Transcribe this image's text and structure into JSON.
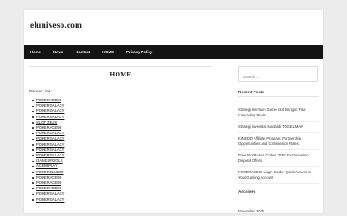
{
  "site": {
    "title": "eluniveso.com"
  },
  "nav": {
    "items": [
      {
        "label": "Home"
      },
      {
        "label": "News"
      },
      {
        "label": "Contact"
      },
      {
        "label": "HOME"
      },
      {
        "label": "Privacy Policy"
      }
    ]
  },
  "main": {
    "page_title": "HOME",
    "partner_label": "Partner Link:",
    "links": [
      "POKERACE99",
      "POKERGALAXY",
      "POKERGALAXY",
      "POKERGALAXY",
      "SLOT ZEUS",
      "POKERACE99",
      "POKERGALAXY",
      "POKERGALAXY",
      "POKERGALAXY",
      "POKERGALAXY",
      "POKERGALAXY",
      "GAMESPOOLS",
      "ACE99PLAY",
      "POKERCLUB88",
      "POKERACE99",
      "POKERACE99",
      "POKERACE99",
      "POKERGALAXY",
      "POKERGALAXY"
    ]
  },
  "sidebar": {
    "search": {
      "placeholder": "Search …"
    },
    "recent_posts_title": "Recent Posts",
    "recent_posts": [
      "Strategi Bermain Game Slot Dengan Fitur Cascading Reels",
      "Strategi Investasi Modal di TOGEL MAP",
      "KINGDD Affiliate Program: Partnership Opportunities and Commission Rates",
      "Free Slot Bonus Codes 2025: Exclusive No Deposit Offers",
      "POKERACE99 Login Guide: Quick Access to Your Gaming Account"
    ],
    "archives_title": "Archives",
    "archives": [
      "November 2025"
    ]
  }
}
